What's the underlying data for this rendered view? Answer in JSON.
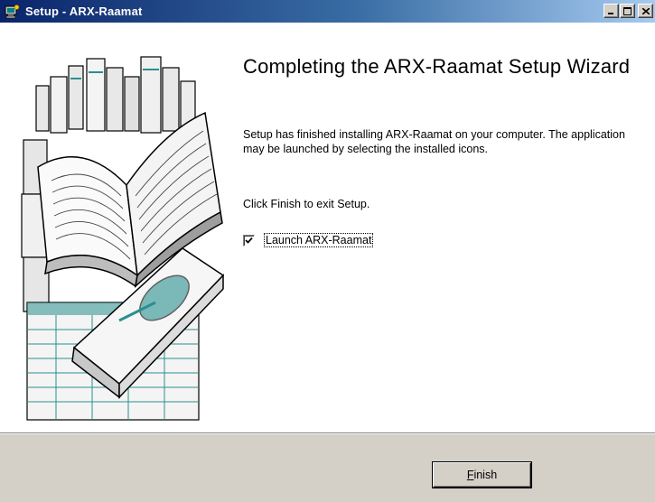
{
  "window": {
    "title": "Setup - ARX-Raamat",
    "icon": "setup-computer-icon",
    "controls": {
      "minimize": "_",
      "maximize": "□",
      "close": "×"
    }
  },
  "wizard": {
    "heading": "Completing the ARX-Raamat Setup Wizard",
    "finished_text": "Setup has finished installing ARX-Raamat on your computer. The application may be launched by selecting the installed icons.",
    "exit_text": "Click Finish to exit Setup.",
    "launch_checkbox": {
      "label": "Launch ARX-Raamat",
      "checked": true
    },
    "side_image": "books-illustration"
  },
  "footer": {
    "finish_button": {
      "accelerator": "F",
      "rest": "inish"
    }
  },
  "colors": {
    "titlebar_start": "#0a246a",
    "titlebar_end": "#a6caf0",
    "face": "#d4d0c8",
    "content_bg": "#ffffff",
    "teal_accent": "#2a8f8f"
  }
}
